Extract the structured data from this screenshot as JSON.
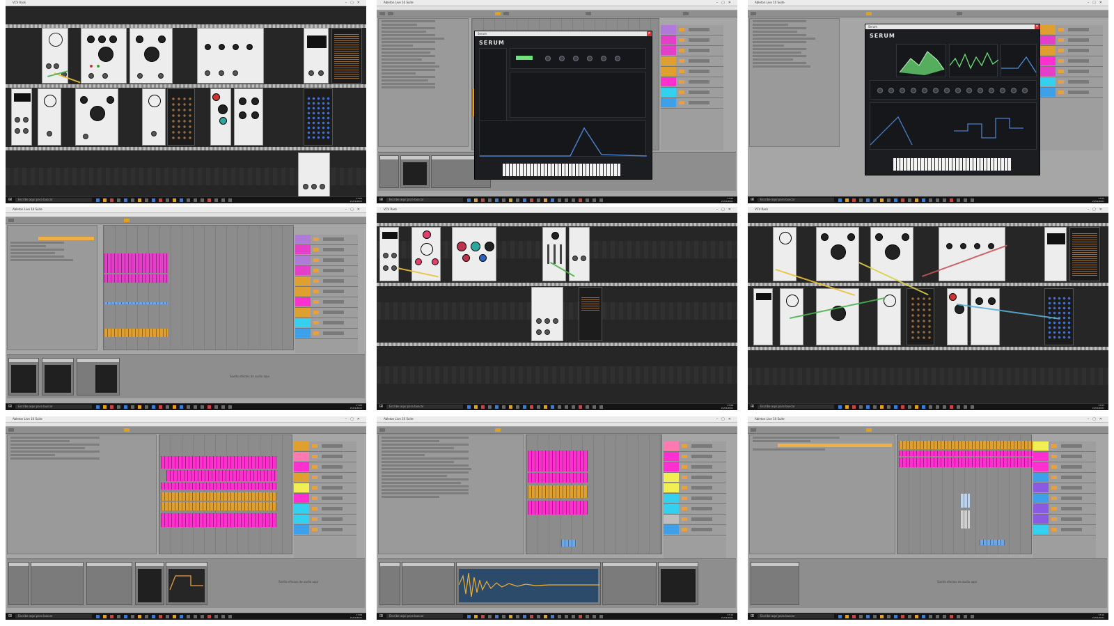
{
  "grid": {
    "columns": 3,
    "rows": 3
  },
  "tiles": [
    {
      "id": "t1",
      "kind": "vcv-rack",
      "window_title": "VCV Rack",
      "taskbar": {
        "search": "Escribe aquí para buscar",
        "time": "17:02",
        "date": "21/01/2021"
      }
    },
    {
      "id": "t2",
      "kind": "ableton-serum",
      "window_title": "Ableton Live 10 Suite",
      "menu": [
        "Archivo",
        "Edición",
        "Crear",
        "Ver",
        "Opciones",
        "Ayuda"
      ],
      "plugin_title": "Serum",
      "plugin_logo": "SERUM",
      "taskbar": {
        "search": "Escribe aquí para buscar",
        "time": "17:02",
        "date": "21/01/2021"
      }
    },
    {
      "id": "t3",
      "kind": "ableton-serum",
      "window_title": "Ableton Live 10 Suite",
      "menu": [
        "Archivo",
        "Edición",
        "Crear",
        "Ver",
        "Opciones",
        "Ayuda"
      ],
      "plugin_title": "Serum",
      "plugin_logo": "SERUM",
      "taskbar": {
        "search": "Escribe aquí para buscar",
        "time": "17:03",
        "date": "21/01/2021"
      }
    },
    {
      "id": "t4",
      "kind": "ableton-arrangement",
      "window_title": "Ableton Live 10 Suite",
      "menu": [
        "Archivo",
        "Edición",
        "Crear",
        "Ver",
        "Opciones",
        "Ayuda"
      ],
      "drop_hint": "Suelta efectos de audio aquí",
      "taskbar": {
        "search": "Escribe aquí para buscar",
        "time": "17:05",
        "date": "21/01/2021"
      }
    },
    {
      "id": "t5",
      "kind": "vcv-rack",
      "window_title": "VCV Rack",
      "taskbar": {
        "search": "Escribe aquí para buscar",
        "time": "17:06",
        "date": "21/01/2021"
      }
    },
    {
      "id": "t6",
      "kind": "vcv-rack",
      "window_title": "VCV Rack",
      "taskbar": {
        "search": "Escribe aquí para buscar",
        "time": "17:07",
        "date": "21/01/2021"
      }
    },
    {
      "id": "t7",
      "kind": "ableton-arrangement",
      "window_title": "Ableton Live 10 Suite",
      "menu": [
        "Archivo",
        "Edición",
        "Crear",
        "Ver",
        "Opciones",
        "Ayuda"
      ],
      "drop_hint": "Suelta efectos de audio aquí",
      "taskbar": {
        "search": "Escribe aquí para buscar",
        "time": "17:09",
        "date": "21/01/2021"
      }
    },
    {
      "id": "t8",
      "kind": "ableton-arrangement",
      "window_title": "Ableton Live 10 Suite",
      "menu": [
        "Archivo",
        "Edición",
        "Crear",
        "Ver",
        "Opciones",
        "Ayuda"
      ],
      "drop_hint": "",
      "taskbar": {
        "search": "Escribe aquí para buscar",
        "time": "17:10",
        "date": "21/01/2021"
      }
    },
    {
      "id": "t9",
      "kind": "ableton-arrangement",
      "window_title": "Ableton Live 10 Suite",
      "menu": [
        "Archivo",
        "Edición",
        "Crear",
        "Ver",
        "Opciones",
        "Ayuda"
      ],
      "drop_hint": "Suelta efectos de audio aquí",
      "taskbar": {
        "search": "Escribe aquí para buscar",
        "time": "17:12",
        "date": "21/01/2021"
      }
    }
  ],
  "colors": {
    "clip_magenta": "#e43fc8",
    "clip_pink": "#ff2fd0",
    "clip_orange": "#e0a030",
    "clip_blue": "#6fa8e8",
    "track_purple": "#b07ad8",
    "track_yellow": "#f2ef55",
    "track_cyan": "#34d0f0",
    "track_blue": "#3da0e8",
    "track_violet": "#8a5ae0",
    "rack_bg": "#262626",
    "module_light": "#ededed",
    "serum_bg": "#1b1d21",
    "serum_wave": "#6fe07a"
  },
  "icons": [
    "windows-start-icon",
    "search-icon",
    "close-icon",
    "minimize-icon",
    "maximize-icon"
  ]
}
